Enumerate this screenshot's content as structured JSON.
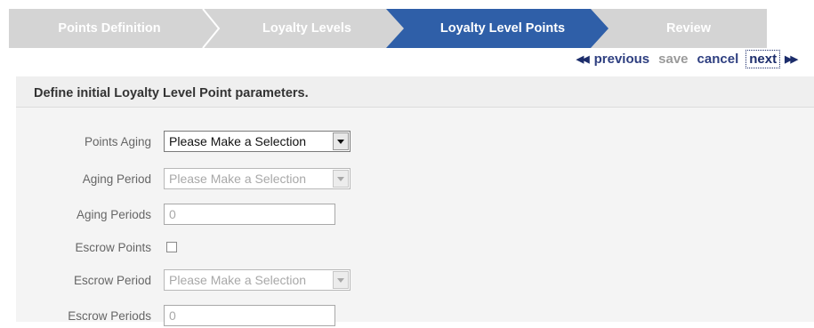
{
  "wizard": {
    "steps": [
      {
        "label": "Points Definition",
        "state": "inactive"
      },
      {
        "label": "Loyalty Levels",
        "state": "inactive"
      },
      {
        "label": "Loyalty Level Points",
        "state": "active"
      },
      {
        "label": "Review",
        "state": "inactive"
      }
    ]
  },
  "actions": {
    "previous": "previous",
    "save": "save",
    "cancel": "cancel",
    "next": "next"
  },
  "panel": {
    "title": "Define initial Loyalty Level Point parameters."
  },
  "form": {
    "points_aging": {
      "label": "Points Aging",
      "value": "Please Make a Selection"
    },
    "aging_period": {
      "label": "Aging Period",
      "value": "Please Make a Selection"
    },
    "aging_periods": {
      "label": "Aging Periods",
      "value": "0"
    },
    "escrow_points": {
      "label": "Escrow Points",
      "checked": false
    },
    "escrow_period": {
      "label": "Escrow Period",
      "value": "Please Make a Selection"
    },
    "escrow_periods": {
      "label": "Escrow Periods",
      "value": "0"
    }
  },
  "colors": {
    "active_step": "#2f5fa8",
    "inactive_bar": "#d4d4d4",
    "link": "#2e3f80"
  }
}
